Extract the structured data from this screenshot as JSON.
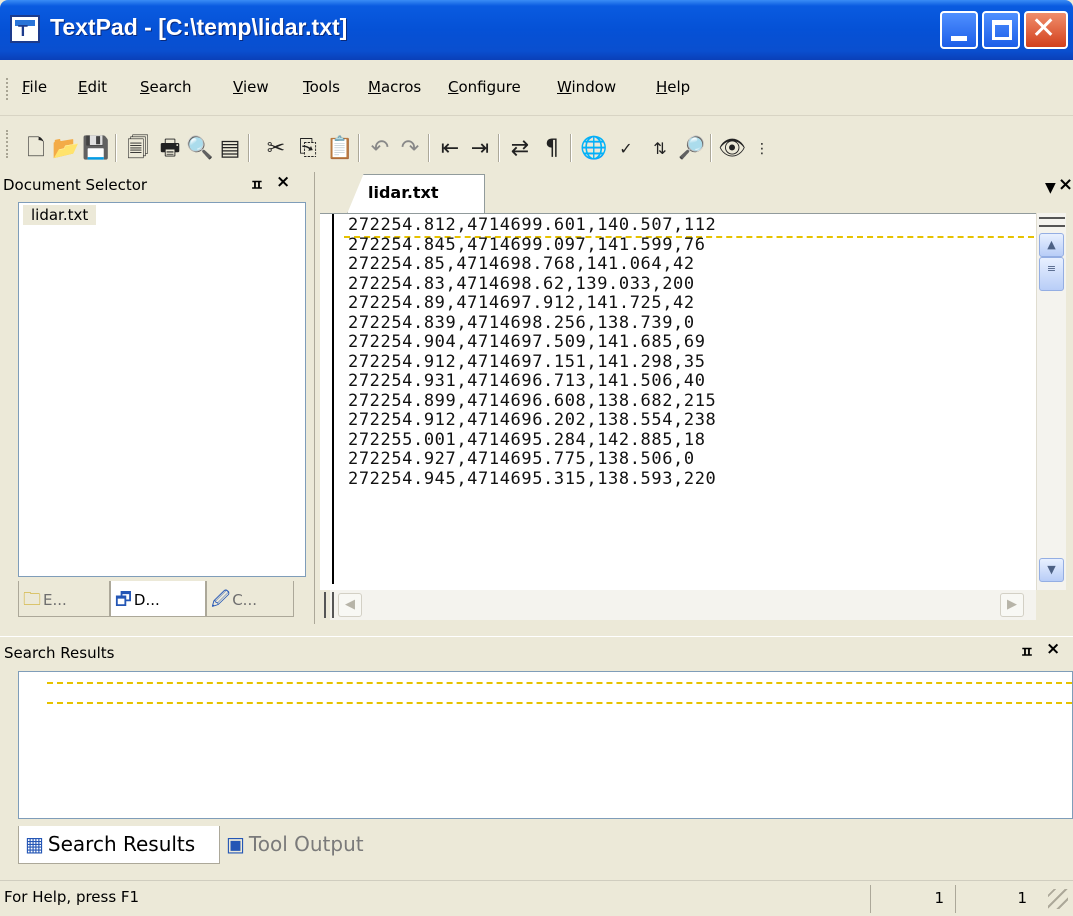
{
  "window": {
    "title": "TextPad - [C:\\temp\\lidar.txt]"
  },
  "menu": [
    "File",
    "Edit",
    "Search",
    "View",
    "Tools",
    "Macros",
    "Configure",
    "Window",
    "Help"
  ],
  "toolbar_icons": [
    "new-file-icon",
    "open-folder-icon",
    "save-icon",
    "save-all-icon",
    "print-icon",
    "print-preview-icon",
    "word-wrap-icon",
    "cut-icon",
    "copy-icon",
    "paste-icon",
    "undo-icon",
    "redo-icon",
    "indent-icon",
    "outdent-icon",
    "reformat-icon",
    "show-paragraph-icon",
    "web-browser-icon",
    "spelling-icon",
    "sort-icon",
    "find-in-files-icon",
    "view-icon"
  ],
  "document_selector": {
    "title": "Document Selector",
    "files": [
      "lidar.txt"
    ],
    "tabs": [
      {
        "label": "E...",
        "icon": "explorer-icon"
      },
      {
        "label": "D...",
        "icon": "documents-icon"
      },
      {
        "label": "C...",
        "icon": "clip-library-icon"
      }
    ]
  },
  "editor": {
    "tab_label": "lidar.txt",
    "lines": [
      "272254.812,4714699.601,140.507,112",
      "272254.845,4714699.097,141.599,76",
      "272254.85,4714698.768,141.064,42",
      "272254.83,4714698.62,139.033,200",
      "272254.89,4714697.912,141.725,42",
      "272254.839,4714698.256,138.739,0",
      "272254.904,4714697.509,141.685,69",
      "272254.912,4714697.151,141.298,35",
      "272254.931,4714696.713,141.506,40",
      "272254.899,4714696.608,138.682,215",
      "272254.912,4714696.202,138.554,238",
      "272255.001,4714695.284,142.885,18",
      "272254.927,4714695.775,138.506,0",
      "272254.945,4714695.315,138.593,220"
    ]
  },
  "search_results": {
    "title": "Search Results",
    "tabs": [
      {
        "label": "Search Results",
        "icon": "search-results-icon"
      },
      {
        "label": "Tool Output",
        "icon": "tool-output-icon"
      }
    ]
  },
  "status": {
    "help": "For Help, press F1",
    "line": "1",
    "column": "1"
  },
  "colors": {
    "title_blue": "#0551d6",
    "chrome": "#ece9d8",
    "caret_line": "#e6c200"
  }
}
